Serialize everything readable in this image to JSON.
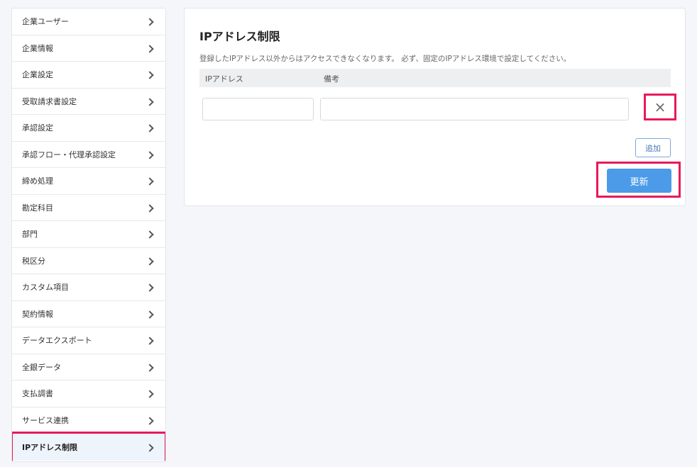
{
  "sidebar": {
    "items": [
      {
        "label": "企業ユーザー"
      },
      {
        "label": "企業情報"
      },
      {
        "label": "企業設定"
      },
      {
        "label": "受取請求書設定"
      },
      {
        "label": "承認設定"
      },
      {
        "label": "承認フロー・代理承認設定"
      },
      {
        "label": "締め処理"
      },
      {
        "label": "勘定科目"
      },
      {
        "label": "部門"
      },
      {
        "label": "税区分"
      },
      {
        "label": "カスタム項目"
      },
      {
        "label": "契約情報"
      },
      {
        "label": "データエクスポート"
      },
      {
        "label": "全銀データ"
      },
      {
        "label": "支払調書"
      },
      {
        "label": "サービス連携"
      },
      {
        "label": "IPアドレス制限"
      }
    ],
    "active_index": 16
  },
  "panel": {
    "title": "IPアドレス制限",
    "description": "登録したIPアドレス以外からはアクセスできなくなります。 必ず、固定のIPアドレス環境で設定してください。",
    "columns": {
      "ip": "IPアドレス",
      "note": "備考"
    },
    "row": {
      "ip_value": "",
      "note_value": ""
    },
    "remove_symbol": "×",
    "add_label": "追加",
    "update_label": "更新"
  },
  "colors": {
    "accent": "#4c9be8",
    "highlight": "#e8195a"
  }
}
